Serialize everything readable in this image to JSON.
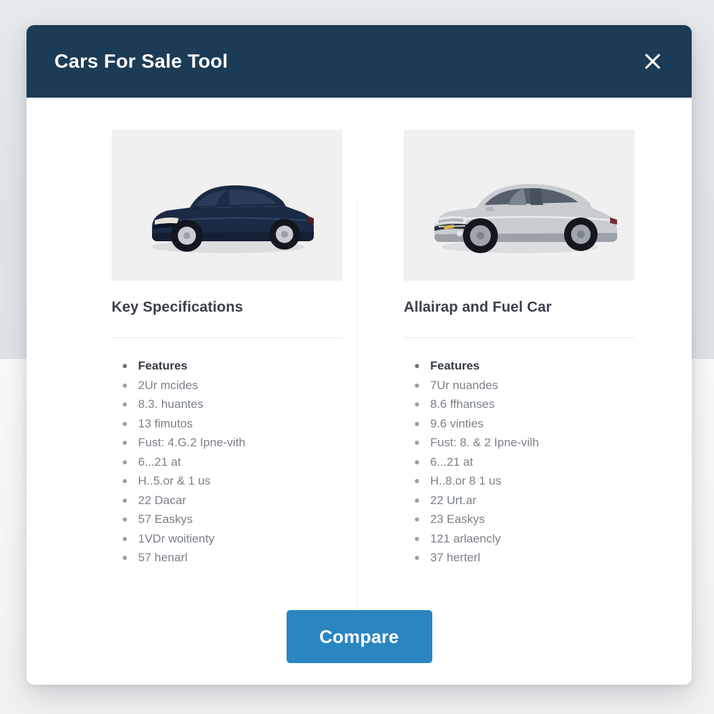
{
  "modal": {
    "title": "Cars For Sale Tool",
    "close_icon": "close-icon",
    "close_label": "Close"
  },
  "columns": [
    {
      "id": "left",
      "photo": {
        "icon": "car-sedan-photo",
        "alt": "Dark navy blue sedan, front three-quarter view",
        "body_color": "#1b2a45",
        "glass_color": "#2a3a57",
        "panel_bg": "#f0f0f1"
      },
      "heading": "Key Specifications",
      "specs": [
        {
          "text": "Features",
          "emphasis": true
        },
        {
          "text": "2Ur mcides",
          "emphasis": false
        },
        {
          "text": "8.3. huantes",
          "emphasis": false
        },
        {
          "text": "13 fimutos",
          "emphasis": false
        },
        {
          "text": "Fust: 4.G.2 Ipne-vith",
          "emphasis": false
        },
        {
          "text": "6...21 at",
          "emphasis": false
        },
        {
          "text": "H..5.or & 1 us",
          "emphasis": false
        },
        {
          "text": "22 Dacar",
          "emphasis": false
        },
        {
          "text": "57 Easkys",
          "emphasis": false
        },
        {
          "text": "1VDr woitienty",
          "emphasis": false
        },
        {
          "text": "57 henarl",
          "emphasis": false
        }
      ]
    },
    {
      "id": "right",
      "photo": {
        "icon": "car-coupe-photo",
        "alt": "Silver sports coupe, front three-quarter view",
        "body_color": "#c9ccd0",
        "glass_color": "#6e757e",
        "panel_bg": "#f0f0f1"
      },
      "heading": "Allairap and Fuel Car",
      "specs": [
        {
          "text": "Features",
          "emphasis": true
        },
        {
          "text": "7Ur nuandes",
          "emphasis": false
        },
        {
          "text": "8.6 ffhanses",
          "emphasis": false
        },
        {
          "text": "9.6 vinties",
          "emphasis": false
        },
        {
          "text": "Fust: 8. & 2 Ipne-vilh",
          "emphasis": false
        },
        {
          "text": "6...21 at",
          "emphasis": false
        },
        {
          "text": "H..8.or 8 1 us",
          "emphasis": false
        },
        {
          "text": "22 Urt.ar",
          "emphasis": false
        },
        {
          "text": "23 Easkys",
          "emphasis": false
        },
        {
          "text": "121 arlaencly",
          "emphasis": false
        },
        {
          "text": "37 herterl",
          "emphasis": false
        }
      ]
    }
  ],
  "footer": {
    "compare_label": "Compare"
  },
  "colors": {
    "header_navy": "#1c3b55",
    "button_blue": "#2a86c0",
    "modal_white": "#ffffff",
    "page_bg_top": "#e2e6ea",
    "page_bg_bottom": "#f7f7f8",
    "photo_panel": "#f0f0f1",
    "heading_text": "#3a4049",
    "spec_text": "#7b8189",
    "divider": "#e7e7e9"
  }
}
